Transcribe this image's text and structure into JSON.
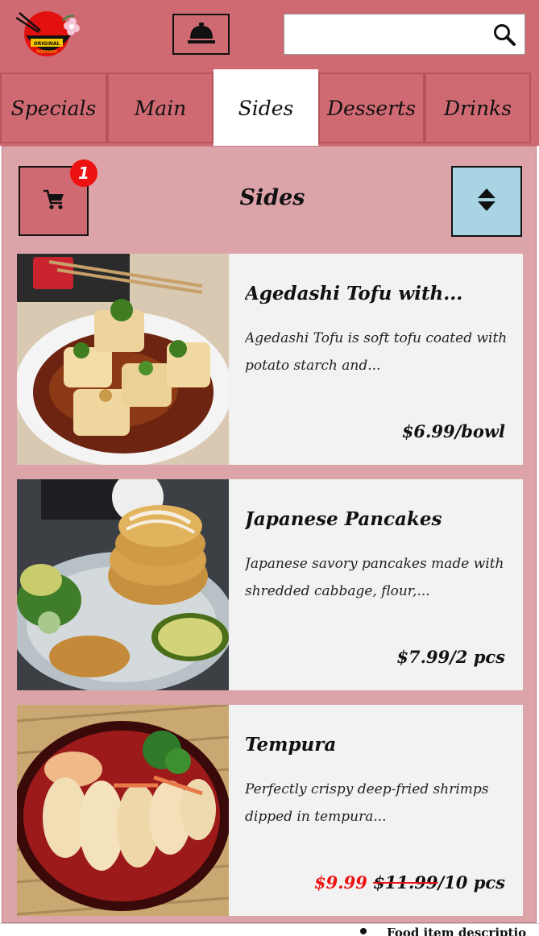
{
  "header": {
    "logo_icon": "ramen-bowl-logo-icon",
    "bell_icon": "service-bell-icon",
    "search": {
      "placeholder": "",
      "value": "",
      "icon": "search-icon"
    }
  },
  "tabs": [
    {
      "label": "Specials",
      "active": false
    },
    {
      "label": "Main",
      "active": false
    },
    {
      "label": "Sides",
      "active": true
    },
    {
      "label": "Desserts",
      "active": false
    },
    {
      "label": "Drinks",
      "active": false
    }
  ],
  "panel": {
    "title": "Sides",
    "cart_count": "1",
    "cart_icon": "cart-icon",
    "sort_icon": "sort-icon",
    "colors": {
      "panel_bg": "#dca4a9",
      "accent": "#d06a72",
      "sort_button": "#a8d4e4",
      "badge": "#ee1111"
    }
  },
  "items": [
    {
      "name": "Agedashi Tofu with...",
      "description": "Agedashi Tofu is soft tofu coated with potato starch and...",
      "price": "$6.99/bowl",
      "image": "agedashi-tofu-photo"
    },
    {
      "name": "Japanese Pancakes",
      "description": "Japanese savory pancakes made with shredded cabbage, flour,...",
      "price": "$7.99/2 pcs",
      "image": "japanese-pancakes-photo"
    },
    {
      "name": "Tempura",
      "description": "Perfectly crispy deep-fried shrimps dipped in tempura...",
      "sale_price": "$9.99",
      "original_price": "$11.99",
      "unit": "/10 pcs",
      "image": "tempura-photo"
    }
  ],
  "footer": {
    "text": "Food item descriptio"
  }
}
